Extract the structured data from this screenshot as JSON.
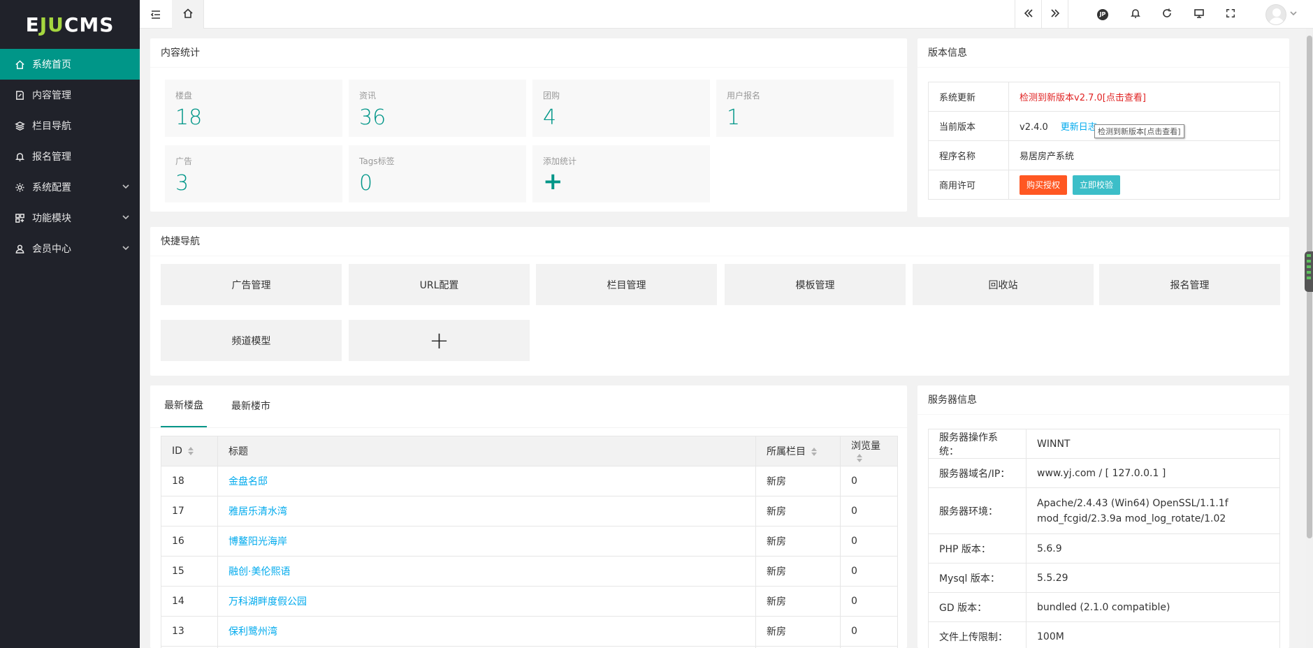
{
  "brand": {
    "logo_prefix": "E",
    "logo_mid": "JU",
    "logo_suffix": "CMS"
  },
  "sidebar": {
    "items": [
      {
        "label": "系统首页",
        "icon": "home-icon",
        "active": true
      },
      {
        "label": "内容管理",
        "icon": "edit-icon",
        "active": false
      },
      {
        "label": "栏目导航",
        "icon": "layers-icon",
        "active": false
      },
      {
        "label": "报名管理",
        "icon": "bell-icon",
        "active": false
      },
      {
        "label": "系统配置",
        "icon": "gear-icon",
        "active": false,
        "expandable": true
      },
      {
        "label": "功能模块",
        "icon": "apps-icon",
        "active": false,
        "expandable": true
      },
      {
        "label": "会员中心",
        "icon": "user-icon",
        "active": false,
        "expandable": true
      }
    ]
  },
  "content_stats": {
    "title": "内容统计",
    "items": [
      {
        "label": "楼盘",
        "value": "18"
      },
      {
        "label": "资讯",
        "value": "36"
      },
      {
        "label": "团购",
        "value": "4"
      },
      {
        "label": "用户报名",
        "value": "1"
      },
      {
        "label": "广告",
        "value": "3"
      },
      {
        "label": "Tags标签",
        "value": "0"
      },
      {
        "label": "添加统计",
        "value": "+"
      }
    ]
  },
  "version_info": {
    "title": "版本信息",
    "update_label": "系统更新",
    "update_value": "检测到新版本v2.7.0[点击查看]",
    "current_label": "当前版本",
    "current_value": "v2.4.0",
    "changelog_link": "更新日志",
    "tooltip": "检测到新版本[点击查看]",
    "program_label": "程序名称",
    "program_value": "易居房产系统",
    "license_label": "商用许可",
    "buy_button": "购买授权",
    "verify_button": "立即校验"
  },
  "quick_nav": {
    "title": "快捷导航",
    "items": [
      "广告管理",
      "URL配置",
      "栏目管理",
      "模板管理",
      "回收站",
      "报名管理",
      "频道模型"
    ],
    "add_label": "+"
  },
  "listings": {
    "tabs": [
      "最新楼盘",
      "最新楼市"
    ],
    "active_tab": 0,
    "columns": [
      "ID",
      "标题",
      "所属栏目",
      "浏览量"
    ],
    "rows": [
      {
        "id": "18",
        "title": "金盘名邸",
        "category": "新房",
        "views": "0"
      },
      {
        "id": "17",
        "title": "雅居乐清水湾",
        "category": "新房",
        "views": "0"
      },
      {
        "id": "16",
        "title": "博鳌阳光海岸",
        "category": "新房",
        "views": "0"
      },
      {
        "id": "15",
        "title": "融创·美伦熙语",
        "category": "新房",
        "views": "0"
      },
      {
        "id": "14",
        "title": "万科湖畔度假公园",
        "category": "新房",
        "views": "0"
      },
      {
        "id": "13",
        "title": "保利鹭州湾",
        "category": "新房",
        "views": "0"
      }
    ]
  },
  "server_info": {
    "title": "服务器信息",
    "rows": [
      {
        "label": "服务器操作系统：",
        "value": "WINNT",
        "value2": ""
      },
      {
        "label": "服务器域名/IP：",
        "value": "www.yj.com / [ 127.0.0.1 ]",
        "value2": ""
      },
      {
        "label": "服务器环境：",
        "value": "Apache/2.4.43 (Win64) OpenSSL/1.1.1f",
        "value2": "mod_fcgid/2.3.9a mod_log_rotate/1.02"
      },
      {
        "label": "PHP 版本：",
        "value": "5.6.9",
        "value2": ""
      },
      {
        "label": "Mysql 版本：",
        "value": "5.5.29",
        "value2": ""
      },
      {
        "label": "GD 版本：",
        "value": "bundled (2.1.0 compatible)",
        "value2": ""
      },
      {
        "label": "文件上传限制：",
        "value": "100M",
        "value2": ""
      }
    ]
  },
  "colors": {
    "accent": "#009688",
    "sidebar_bg": "#20222a",
    "link": "#01aaed",
    "alert": "#e02222",
    "buy": "#ff5722",
    "verify": "#3cbec8"
  },
  "topbar": {
    "icons": [
      "menu-fold-icon",
      "home-icon",
      "chevrons-left-icon",
      "chevrons-right-icon",
      "theme-icon",
      "bell-icon",
      "refresh-icon",
      "monitor-icon",
      "fullscreen-icon",
      "avatar",
      "chevron-down-icon"
    ]
  }
}
